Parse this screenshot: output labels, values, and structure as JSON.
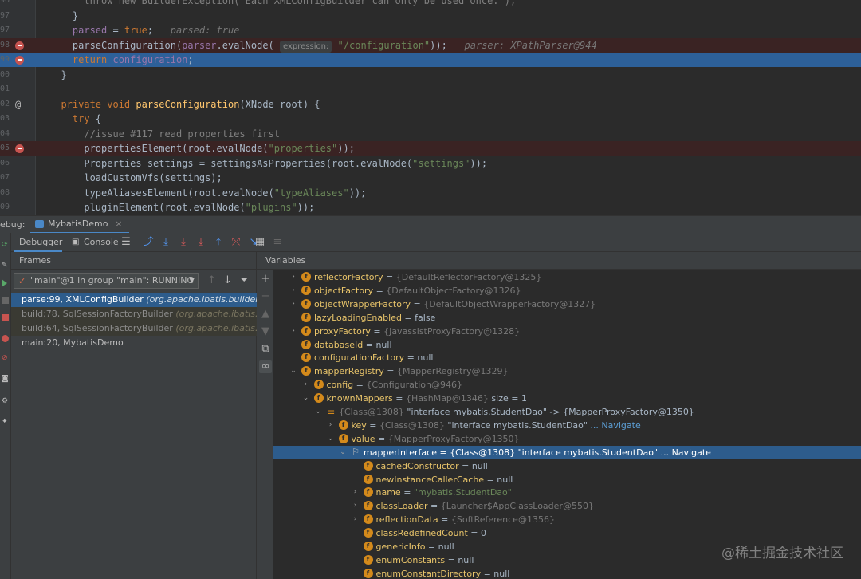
{
  "editor": {
    "lines": [
      {
        "num": "96",
        "kind": "plain",
        "code": [
          {
            "t": "      throw new BuilderException(\"Each XMLConfigBuilder can only be used once.\");",
            "c": "cmt"
          }
        ]
      },
      {
        "num": "97",
        "kind": "plain",
        "code": [
          {
            "t": "    }",
            "c": ""
          }
        ]
      },
      {
        "num": "97",
        "kind": "plain",
        "code": [
          {
            "t": "    parsed",
            "c": "fld"
          },
          {
            "t": " = ",
            "c": ""
          },
          {
            "t": "true",
            "c": "kw"
          },
          {
            "t": ";   ",
            "c": ""
          },
          {
            "t": "parsed: true",
            "c": "hint"
          }
        ]
      },
      {
        "num": "98",
        "kind": "bp",
        "code": [
          {
            "t": "    parseConfiguration(",
            "c": ""
          },
          {
            "t": "parser",
            "c": "fld"
          },
          {
            "t": ".evalNode( ",
            "c": ""
          },
          {
            "t": "expression:",
            "c": "pill"
          },
          {
            "t": " \"/configuration\"",
            "c": "str"
          },
          {
            "t": "));   ",
            "c": ""
          },
          {
            "t": "parser: XPathParser@944",
            "c": "hint"
          }
        ]
      },
      {
        "num": "99",
        "kind": "cur",
        "code": [
          {
            "t": "    return ",
            "c": "kw"
          },
          {
            "t": "configuration",
            "c": "fld"
          },
          {
            "t": ";",
            "c": ""
          }
        ]
      },
      {
        "num": "00",
        "kind": "plain",
        "code": [
          {
            "t": "  }",
            "c": ""
          }
        ]
      },
      {
        "num": "01",
        "kind": "plain",
        "code": [
          {
            "t": "",
            "c": ""
          }
        ]
      },
      {
        "num": "02",
        "kind": "at",
        "code": [
          {
            "t": "  private void ",
            "c": "kw"
          },
          {
            "t": "parseConfiguration",
            "c": "mth"
          },
          {
            "t": "(XNode root) {",
            "c": ""
          }
        ]
      },
      {
        "num": "03",
        "kind": "plain",
        "code": [
          {
            "t": "    try ",
            "c": "kw"
          },
          {
            "t": "{",
            "c": ""
          }
        ]
      },
      {
        "num": "04",
        "kind": "plain",
        "code": [
          {
            "t": "      //issue #117 read properties first",
            "c": "cmt"
          }
        ]
      },
      {
        "num": "05",
        "kind": "bp",
        "code": [
          {
            "t": "      propertiesElement(root.evalNode(",
            "c": ""
          },
          {
            "t": "\"properties\"",
            "c": "str"
          },
          {
            "t": "));",
            "c": ""
          }
        ]
      },
      {
        "num": "06",
        "kind": "plain",
        "code": [
          {
            "t": "      Properties settings = settingsAsProperties(root.evalNode(",
            "c": ""
          },
          {
            "t": "\"settings\"",
            "c": "str"
          },
          {
            "t": "));",
            "c": ""
          }
        ]
      },
      {
        "num": "07",
        "kind": "plain",
        "code": [
          {
            "t": "      loadCustomVfs(settings);",
            "c": ""
          }
        ]
      },
      {
        "num": "08",
        "kind": "plain",
        "code": [
          {
            "t": "      typeAliasesElement(root.evalNode(",
            "c": ""
          },
          {
            "t": "\"typeAliases\"",
            "c": "str"
          },
          {
            "t": "));",
            "c": ""
          }
        ]
      },
      {
        "num": "09",
        "kind": "plain",
        "code": [
          {
            "t": "      pluginElement(root.evalNode(",
            "c": ""
          },
          {
            "t": "\"plugins\"",
            "c": "str"
          },
          {
            "t": "));",
            "c": ""
          }
        ]
      }
    ]
  },
  "debug": {
    "label": "ebug:",
    "tab_label": "MybatisDemo",
    "tab_close": "×",
    "tabs": {
      "debugger": "Debugger",
      "console": "Console"
    }
  },
  "frames": {
    "header": "Frames",
    "thread": "\"main\"@1 in group \"main\": RUNNING",
    "items": [
      {
        "text": "parse:99, XMLConfigBuilder ",
        "pkg": "(org.apache.ibatis.builder.xml)",
        "kind": "sel"
      },
      {
        "text": "build:78, SqlSessionFactoryBuilder ",
        "pkg": "(org.apache.ibatis.session)",
        "kind": "lib"
      },
      {
        "text": "build:64, SqlSessionFactoryBuilder ",
        "pkg": "(org.apache.ibatis.session)",
        "kind": "lib"
      },
      {
        "text": "main:20, MybatisDemo",
        "pkg": "",
        "kind": "plain"
      }
    ]
  },
  "variables": {
    "header": "Variables",
    "rows": [
      {
        "depth": 0,
        "arrow": "›",
        "icon": "f",
        "name": "reflectorFactory",
        "type": "{DefaultReflectorFactory@1325}",
        "value": "",
        "extra": ""
      },
      {
        "depth": 0,
        "arrow": "›",
        "icon": "f",
        "name": "objectFactory",
        "type": "{DefaultObjectFactory@1326}",
        "value": "",
        "extra": ""
      },
      {
        "depth": 0,
        "arrow": "›",
        "icon": "f",
        "name": "objectWrapperFactory",
        "type": "{DefaultObjectWrapperFactory@1327}",
        "value": "",
        "extra": ""
      },
      {
        "depth": 0,
        "arrow": "",
        "icon": "f",
        "name": "lazyLoadingEnabled",
        "type": "",
        "value": "false",
        "extra": ""
      },
      {
        "depth": 0,
        "arrow": "›",
        "icon": "f",
        "name": "proxyFactory",
        "type": "{JavassistProxyFactory@1328}",
        "value": "",
        "extra": ""
      },
      {
        "depth": 0,
        "arrow": "",
        "icon": "f",
        "name": "databaseId",
        "type": "",
        "value": "null",
        "extra": ""
      },
      {
        "depth": 0,
        "arrow": "",
        "icon": "f",
        "name": "configurationFactory",
        "type": "",
        "value": "null",
        "extra": ""
      },
      {
        "depth": 0,
        "arrow": "⌄",
        "icon": "f",
        "name": "mapperRegistry",
        "type": "{MapperRegistry@1329}",
        "value": "",
        "extra": ""
      },
      {
        "depth": 1,
        "arrow": "›",
        "icon": "f",
        "name": "config",
        "type": "{Configuration@946}",
        "value": "",
        "extra": ""
      },
      {
        "depth": 1,
        "arrow": "⌄",
        "icon": "f",
        "name": "knownMappers",
        "type": "{HashMap@1346}",
        "value": "",
        "extra": "  size = 1"
      },
      {
        "depth": 2,
        "arrow": "⌄",
        "icon": "list",
        "name": "",
        "type": "{Class@1308}",
        "value": " \"interface mybatis.StudentDao\"",
        "extra": " -> {MapperProxyFactory@1350}"
      },
      {
        "depth": 3,
        "arrow": "›",
        "icon": "f",
        "name": "key",
        "type": "{Class@1308}",
        "value": " \"interface mybatis.StudentDao\"",
        "extra": " ... Navigate"
      },
      {
        "depth": 3,
        "arrow": "⌄",
        "icon": "f",
        "name": "value",
        "type": "{MapperProxyFactory@1350}",
        "value": "",
        "extra": ""
      },
      {
        "depth": 4,
        "arrow": "⌄",
        "icon": "p",
        "name": "mapperInterface",
        "type": "{Class@1308}",
        "value": " \"interface mybatis.StudentDao\"",
        "extra": " ... Navigate",
        "sel": true
      },
      {
        "depth": 5,
        "arrow": "",
        "icon": "f",
        "name": "cachedConstructor",
        "type": "",
        "value": "null",
        "extra": ""
      },
      {
        "depth": 5,
        "arrow": "",
        "icon": "f",
        "name": "newInstanceCallerCache",
        "type": "",
        "value": "null",
        "extra": ""
      },
      {
        "depth": 5,
        "arrow": "›",
        "icon": "f",
        "name": "name",
        "type": "",
        "value": "\"mybatis.StudentDao\"",
        "extra": "",
        "str": true
      },
      {
        "depth": 5,
        "arrow": "›",
        "icon": "f",
        "name": "classLoader",
        "type": "{Launcher$AppClassLoader@550}",
        "value": "",
        "extra": ""
      },
      {
        "depth": 5,
        "arrow": "›",
        "icon": "f",
        "name": "reflectionData",
        "type": "{SoftReference@1356}",
        "value": "",
        "extra": ""
      },
      {
        "depth": 5,
        "arrow": "",
        "icon": "f",
        "name": "classRedefinedCount",
        "type": "",
        "value": "0",
        "extra": ""
      },
      {
        "depth": 5,
        "arrow": "",
        "icon": "f",
        "name": "genericInfo",
        "type": "",
        "value": "null",
        "extra": ""
      },
      {
        "depth": 5,
        "arrow": "",
        "icon": "f",
        "name": "enumConstants",
        "type": "",
        "value": "null",
        "extra": ""
      },
      {
        "depth": 5,
        "arrow": "",
        "icon": "f",
        "name": "enumConstantDirectory",
        "type": "",
        "value": "null",
        "extra": ""
      }
    ]
  },
  "watermark": "@稀土掘金技术社区",
  "colors": {
    "accent": "#4a88c7",
    "selection": "#2d5c8c",
    "breakpoint": "#c75450",
    "field_icon": "#d48a1b"
  }
}
